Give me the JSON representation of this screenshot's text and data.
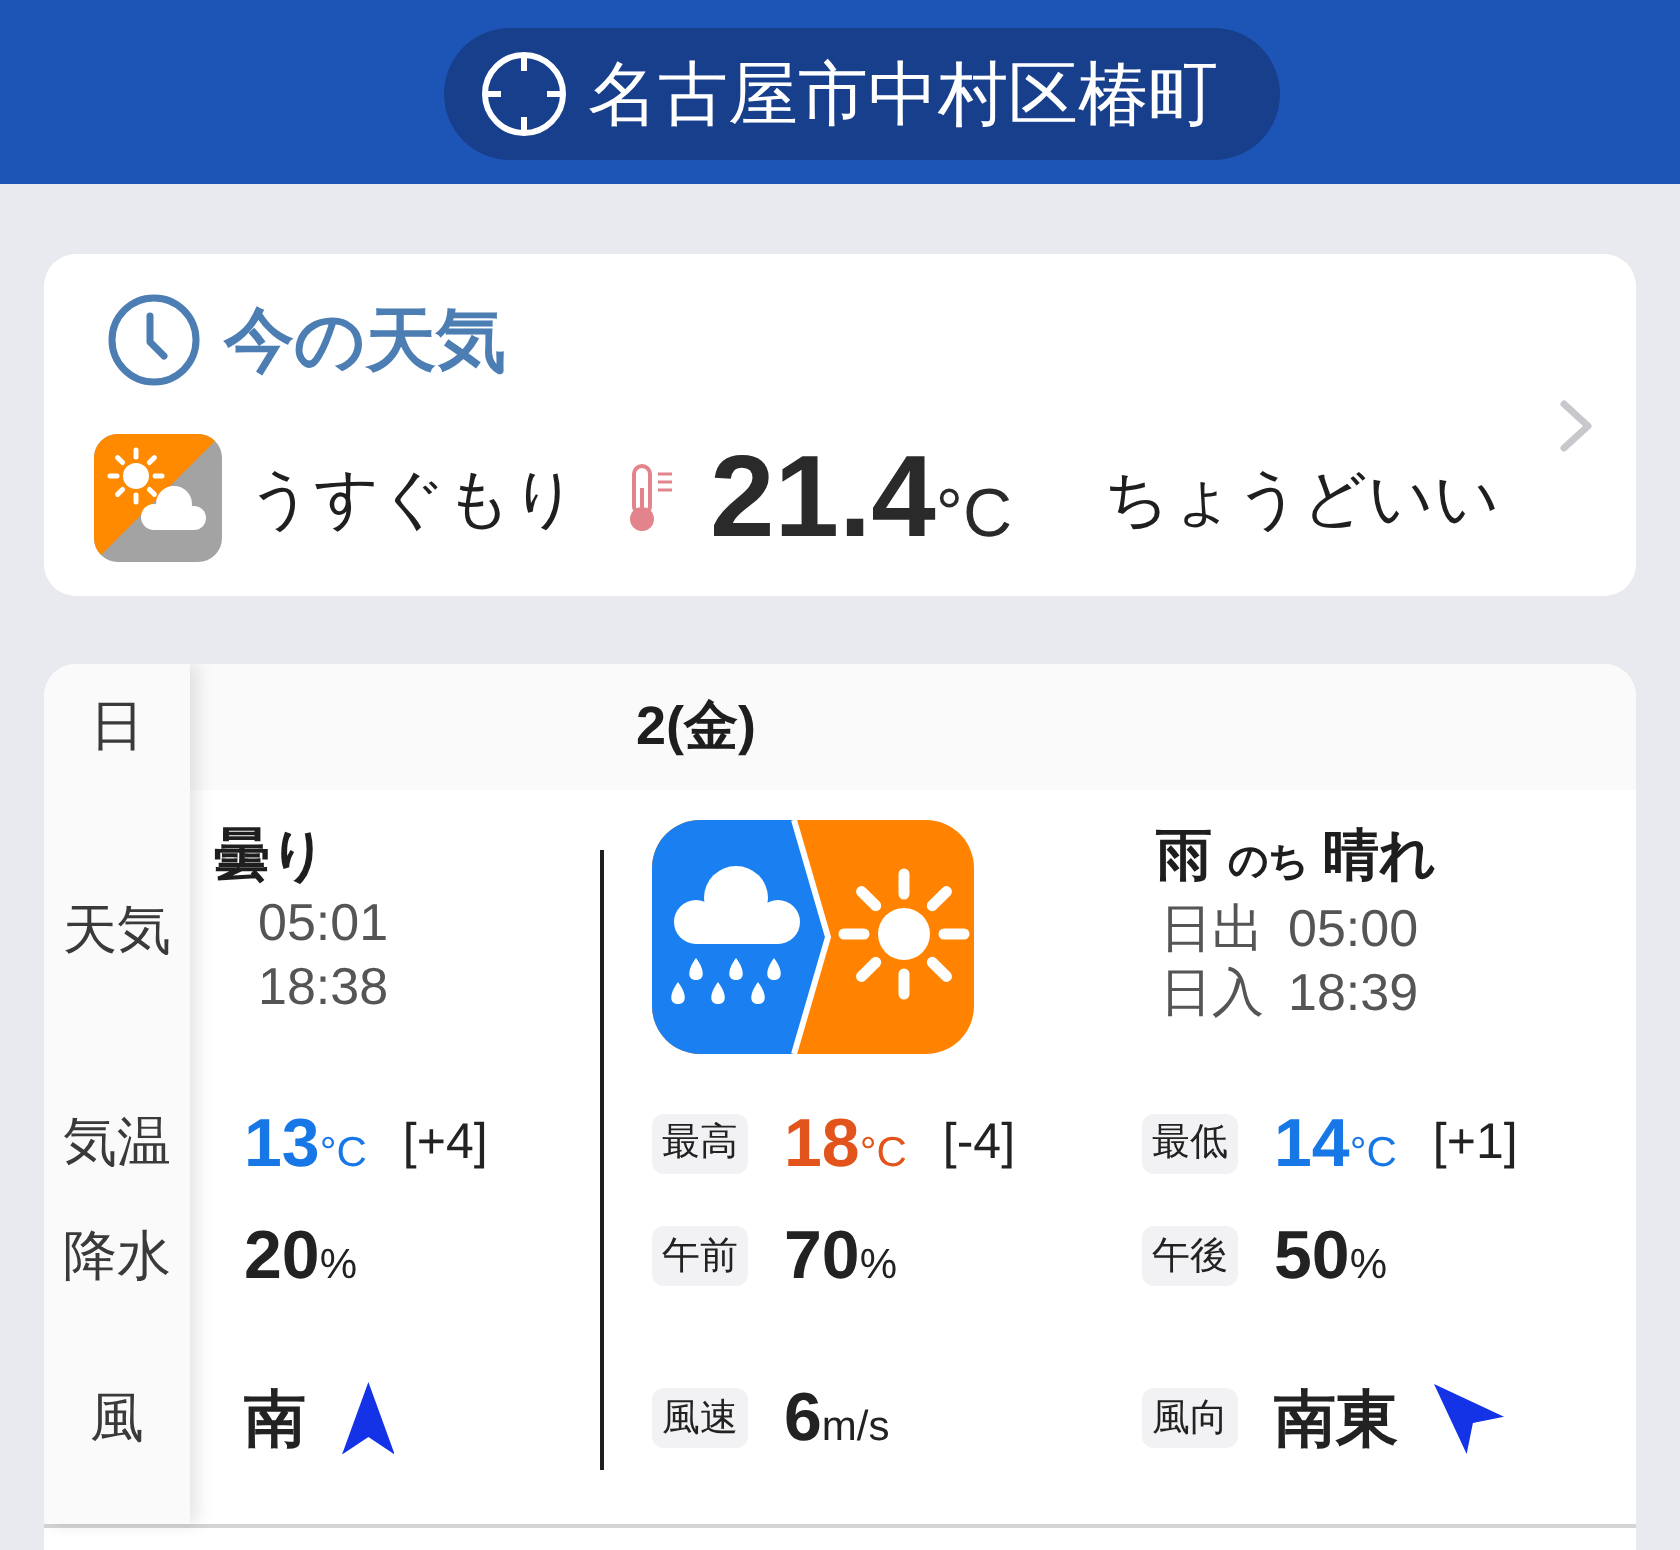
{
  "header": {
    "location": "名古屋市中村区椿町"
  },
  "current": {
    "title": "今の天気",
    "condition": "うすぐもり",
    "temperature": "21.4",
    "unit": "°C",
    "comfort": "ちょうどいい"
  },
  "forecast": {
    "corner_label": "日",
    "date": "2(金)",
    "rows": [
      {
        "label": "天気",
        "cells": [
          {
            "kind": "summary",
            "weather": [
              {
                "text": "曇り",
                "kind": "main"
              }
            ],
            "sunrise": {
              "time": "05:01"
            },
            "sunset": {
              "time": "18:38"
            }
          },
          {
            "kind": "weather_icon"
          },
          {
            "kind": "summary",
            "weather": [
              {
                "text": "雨",
                "kind": "main"
              },
              {
                "text": "のち",
                "kind": "joiner"
              },
              {
                "text": "晴れ",
                "kind": "main"
              }
            ],
            "sunrise": {
              "label": "日出",
              "time": "05:00"
            },
            "sunset": {
              "label": "日入",
              "time": "18:39"
            }
          }
        ]
      },
      {
        "label": "気温",
        "cells": [
          {
            "kind": "temperature",
            "color": "#1877e6",
            "value": "13",
            "unit": "°C",
            "diff": "[+4]"
          },
          {
            "kind": "temperature",
            "tag": "最高",
            "color": "#e2541c",
            "value": "18",
            "unit": "°C",
            "diff": "[-4]"
          },
          {
            "kind": "temperature",
            "tag": "最低",
            "color": "#1877e6",
            "value": "14",
            "unit": "°C",
            "diff": "[+1]"
          }
        ]
      },
      {
        "label": "降水",
        "cells": [
          {
            "kind": "precipitation",
            "value": "20",
            "unit": "%"
          },
          {
            "kind": "precipitation",
            "tag": "午前",
            "value": "70",
            "unit": "%"
          },
          {
            "kind": "precipitation",
            "tag": "午後",
            "value": "50",
            "unit": "%"
          }
        ]
      },
      {
        "label": "風",
        "cells": [
          {
            "kind": "wind_direction",
            "value": "南",
            "arrow": {
              "kind": "up"
            }
          },
          {
            "kind": "wind_speed",
            "tag": "風速",
            "value": "6",
            "unit": "m/s"
          },
          {
            "kind": "wind_direction",
            "tag": "風向",
            "value": "南東",
            "arrow": {
              "kind": "up_left"
            }
          }
        ]
      }
    ]
  }
}
